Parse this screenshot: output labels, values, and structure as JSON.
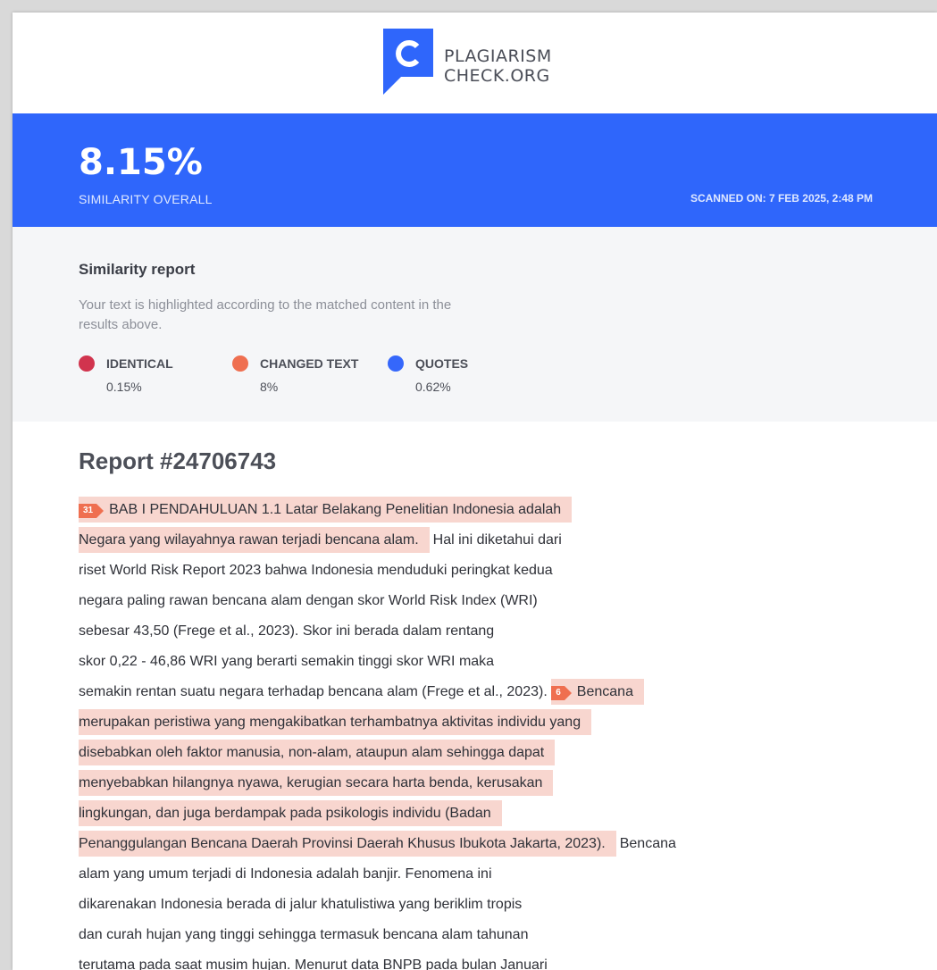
{
  "brand": {
    "line1": "PLAGIARISM",
    "line2": "CHECK.ORG",
    "color": "#2f66fb"
  },
  "summary": {
    "similarity": "8.15%",
    "similarity_label": "SIMILARITY OVERALL",
    "scanned": "SCANNED ON: 7 FEB 2025, 2:48 PM"
  },
  "legend": {
    "title": "Similarity report",
    "description": "Your text is highlighted according to the matched content in the results above.",
    "items": [
      {
        "name": "IDENTICAL",
        "value": "0.15%",
        "color": "#d1344e"
      },
      {
        "name": "CHANGED TEXT",
        "value": "8%",
        "color": "#ef6f50"
      },
      {
        "name": "QUOTES",
        "value": "0.62%",
        "color": "#3567fb"
      }
    ]
  },
  "report": {
    "title": "Report #24706743",
    "highlight_color": "#f8d6cf",
    "lines": [
      {
        "badge": "31",
        "hl": "BAB I PENDAHULUAN 1.1 Latar Belakang Penelitian Indonesia adalah",
        "text": ""
      },
      {
        "hl": "Negara yang wilayahnya rawan terjadi bencana alam.",
        "text": "Hal ini diketahui dari"
      },
      {
        "text": "riset World Risk Report 2023 bahwa Indonesia menduduki peringkat kedua"
      },
      {
        "text": "negara paling rawan bencana alam dengan skor World Risk Index (WRI)"
      },
      {
        "text": "sebesar 43,50 (Frege et al., 2023). Skor ini berada dalam rentang"
      },
      {
        "text": "skor 0,22 - 46,86 WRI yang berarti semakin tinggi skor WRI maka"
      },
      {
        "pre": "semakin rentan suatu negara terhadap bencana alam (Frege et al., 2023).",
        "badge": "6",
        "hl": "Bencana"
      },
      {
        "hl": "merupakan peristiwa yang mengakibatkan terhambatnya aktivitas individu yang"
      },
      {
        "hl": "disebabkan oleh faktor manusia, non-alam, ataupun alam sehingga dapat"
      },
      {
        "hl": "menyebabkan hilangnya nyawa, kerugian secara harta benda, kerusakan"
      },
      {
        "hl": "lingkungan, dan juga berdampak pada psikologis individu (Badan"
      },
      {
        "hl": "Penanggulangan Bencana Daerah Provinsi Daerah Khusus Ibukota Jakarta, 2023).",
        "text": "Bencana"
      },
      {
        "text": "alam yang umum terjadi di Indonesia adalah banjir. Fenomena ini"
      },
      {
        "text": "dikarenakan Indonesia berada di jalur khatulistiwa yang beriklim tropis"
      },
      {
        "text": "dan curah hujan yang tinggi sehingga termasuk bencana alam tahunan"
      },
      {
        "text": "terutama pada saat musim hujan. Menurut data BNPB pada bulan Januari"
      }
    ]
  }
}
